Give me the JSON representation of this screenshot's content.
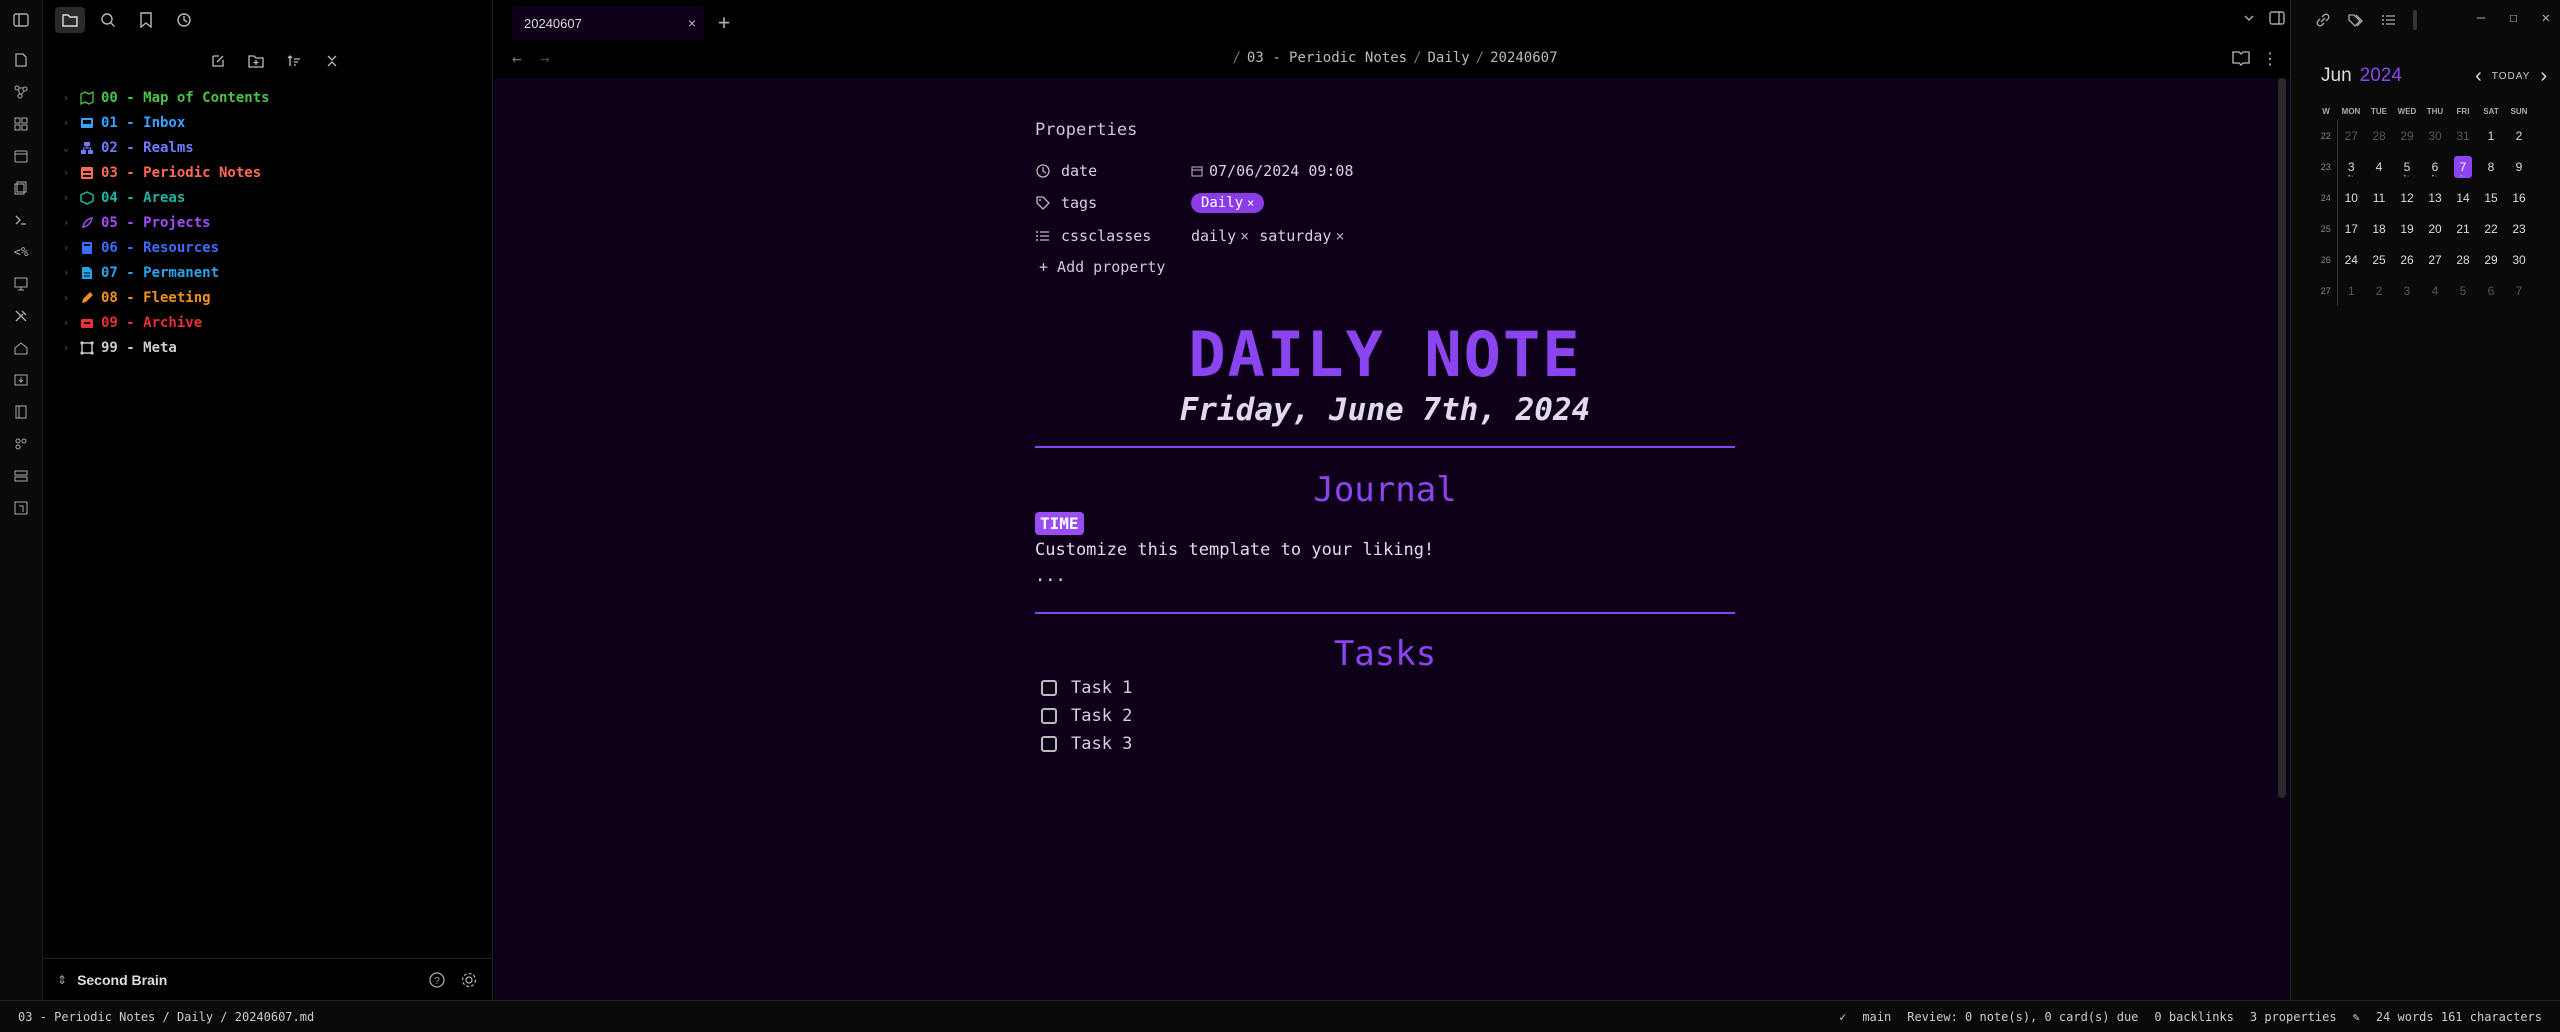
{
  "tab": {
    "title": "20240607",
    "close": "×",
    "add": "+"
  },
  "breadcrumb": {
    "sep": "/",
    "parts": [
      "03 - Periodic Notes",
      "Daily",
      "20240607"
    ]
  },
  "nav": {
    "back": "←",
    "forward": "→"
  },
  "tree": [
    {
      "label": "00 - Map of Contents",
      "color": "#4cc24c",
      "icon": "map-icon",
      "chev": "›"
    },
    {
      "label": "01 - Inbox",
      "color": "#3aa0ff",
      "icon": "inbox-icon",
      "chev": "›"
    },
    {
      "label": "02 - Realms",
      "color": "#6f7bff",
      "icon": "realms-icon",
      "chev": "⌄"
    },
    {
      "label": "03 - Periodic Notes",
      "color": "#ff6a55",
      "icon": "calendar-icon",
      "chev": "›"
    },
    {
      "label": "04 - Areas",
      "color": "#20b3a0",
      "icon": "areas-icon",
      "chev": "›"
    },
    {
      "label": "05 - Projects",
      "color": "#a24cf5",
      "icon": "rocket-icon",
      "chev": "›"
    },
    {
      "label": "06 - Resources",
      "color": "#3b6dff",
      "icon": "book-icon",
      "chev": "›"
    },
    {
      "label": "07 - Permanent",
      "color": "#2aa3e6",
      "icon": "note-icon",
      "chev": "›"
    },
    {
      "label": "08 - Fleeting",
      "color": "#f09020",
      "icon": "pencil-icon",
      "chev": "›"
    },
    {
      "label": "09 - Archive",
      "color": "#e8303a",
      "icon": "archive-icon",
      "chev": "›"
    },
    {
      "label": "99 - Meta",
      "color": "#cccccc",
      "icon": "meta-icon",
      "chev": "›"
    }
  ],
  "vault": {
    "name": "Second Brain"
  },
  "properties": {
    "title": "Properties",
    "date_key": "date",
    "date_val": "07/06/2024 09:08",
    "tags_key": "tags",
    "tag": "Daily",
    "tag_x": "×",
    "cssclasses_key": "cssclasses",
    "classes": [
      "daily",
      "saturday"
    ],
    "class_x": "×",
    "add_label": "+ Add property"
  },
  "note": {
    "heading": "DAILY NOTE",
    "date_line": "Friday, June 7th, 2024",
    "journal_heading": "Journal",
    "time_tag": "TIME",
    "customize": "Customize this template to your liking!",
    "ellipsis": "...",
    "tasks_heading": "Tasks",
    "tasks": [
      "Task 1",
      "Task 2",
      "Task 3"
    ]
  },
  "calendar": {
    "month": "Jun",
    "year": "2024",
    "today_label": "TODAY",
    "prev": "‹",
    "next": "›",
    "headers": [
      "W",
      "MON",
      "TUE",
      "WED",
      "THU",
      "FRI",
      "SAT",
      "SUN"
    ],
    "weeks": [
      {
        "wk": "22",
        "days": [
          [
            "27",
            true
          ],
          [
            "28",
            true
          ],
          [
            "29",
            true
          ],
          [
            "30",
            true
          ],
          [
            "31",
            true
          ],
          [
            "1",
            false
          ],
          [
            "2",
            false
          ]
        ]
      },
      {
        "wk": "23",
        "days": [
          [
            "3",
            false
          ],
          [
            "4",
            false
          ],
          [
            "5",
            false
          ],
          [
            "6",
            false
          ],
          [
            "7",
            false
          ],
          [
            "8",
            false
          ],
          [
            "9",
            false
          ]
        ]
      },
      {
        "wk": "24",
        "days": [
          [
            "10",
            false
          ],
          [
            "11",
            false
          ],
          [
            "12",
            false
          ],
          [
            "13",
            false
          ],
          [
            "14",
            false
          ],
          [
            "15",
            false
          ],
          [
            "16",
            false
          ]
        ]
      },
      {
        "wk": "25",
        "days": [
          [
            "17",
            false
          ],
          [
            "18",
            false
          ],
          [
            "19",
            false
          ],
          [
            "20",
            false
          ],
          [
            "21",
            false
          ],
          [
            "22",
            false
          ],
          [
            "23",
            false
          ]
        ]
      },
      {
        "wk": "26",
        "days": [
          [
            "24",
            false
          ],
          [
            "25",
            false
          ],
          [
            "26",
            false
          ],
          [
            "27",
            false
          ],
          [
            "28",
            false
          ],
          [
            "29",
            false
          ],
          [
            "30",
            false
          ]
        ]
      },
      {
        "wk": "27",
        "days": [
          [
            "1",
            true
          ],
          [
            "2",
            true
          ],
          [
            "3",
            true
          ],
          [
            "4",
            true
          ],
          [
            "5",
            true
          ],
          [
            "6",
            true
          ],
          [
            "7",
            true
          ]
        ]
      }
    ],
    "selected": "7"
  },
  "status": {
    "path": "03 - Periodic Notes / Daily / 20240607.md",
    "branch": "main",
    "review": "Review: 0 note(s), 0 card(s) due",
    "backlinks": "0 backlinks",
    "props": "3 properties",
    "words": "24 words 161 characters"
  },
  "colors": {
    "accent": "#8b45f0",
    "editor_bg": "#0e0018"
  }
}
